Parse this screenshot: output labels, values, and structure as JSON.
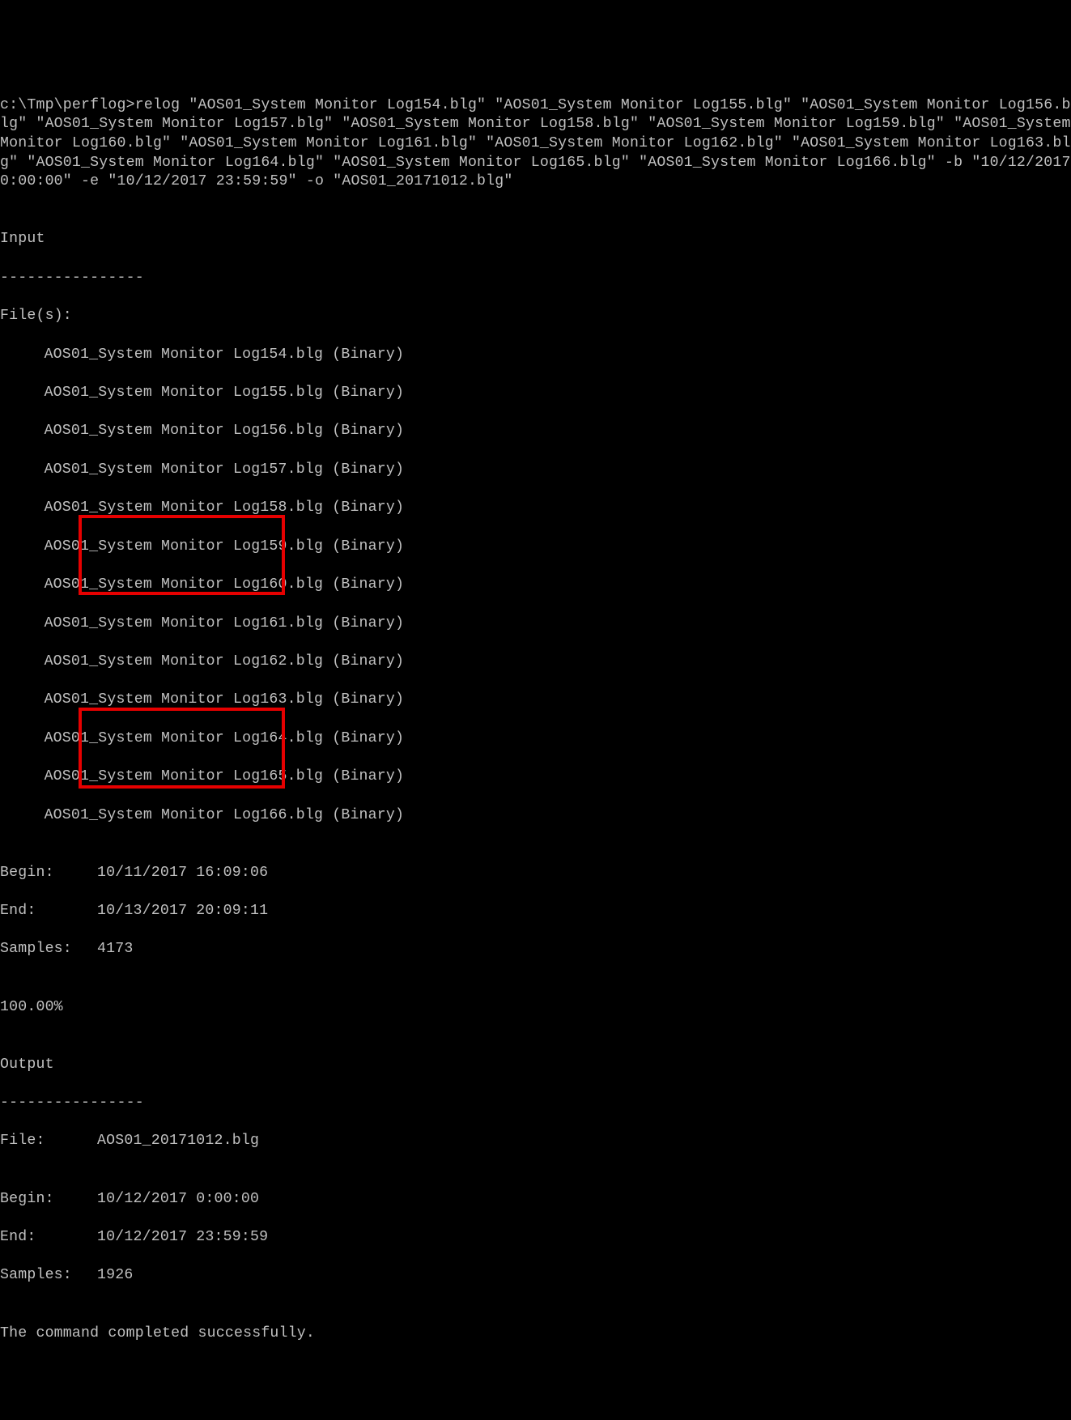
{
  "prompt": "c:\\Tmp\\perflog>",
  "command": "relog \"AOS01_System Monitor Log154.blg\" \"AOS01_System Monitor Log155.blg\" \"AOS01_System Monitor Log156.blg\" \"AOS01_System Monitor Log157.blg\" \"AOS01_System Monitor Log158.blg\" \"AOS01_System Monitor Log159.blg\" \"AOS01_System Monitor Log160.blg\" \"AOS01_System Monitor Log161.blg\" \"AOS01_System Monitor Log162.blg\" \"AOS01_System Monitor Log163.blg\" \"AOS01_System Monitor Log164.blg\" \"AOS01_System Monitor Log165.blg\" \"AOS01_System Monitor Log166.blg\" -b \"10/12/2017 0:00:00\" -e \"10/12/2017 23:59:59\" -o \"AOS01_20171012.blg\"",
  "blank": "",
  "input_heading": "Input",
  "dashes": "----------------",
  "files_heading": "File(s):",
  "files": [
    "AOS01_System Monitor Log154.blg (Binary)",
    "AOS01_System Monitor Log155.blg (Binary)",
    "AOS01_System Monitor Log156.blg (Binary)",
    "AOS01_System Monitor Log157.blg (Binary)",
    "AOS01_System Monitor Log158.blg (Binary)",
    "AOS01_System Monitor Log159.blg (Binary)",
    "AOS01_System Monitor Log160.blg (Binary)",
    "AOS01_System Monitor Log161.blg (Binary)",
    "AOS01_System Monitor Log162.blg (Binary)",
    "AOS01_System Monitor Log163.blg (Binary)",
    "AOS01_System Monitor Log164.blg (Binary)",
    "AOS01_System Monitor Log165.blg (Binary)",
    "AOS01_System Monitor Log166.blg (Binary)"
  ],
  "input_stats": {
    "begin_label": "Begin:",
    "begin_value": "10/11/2017 16:09:06",
    "end_label": "End:",
    "end_value": "10/13/2017 20:09:11",
    "samples_label": "Samples:",
    "samples_value": "4173"
  },
  "percent": "100.00%",
  "output_heading": "Output",
  "output_file_label": "File:",
  "output_file_value": "AOS01_20171012.blg",
  "output_stats": {
    "begin_label": "Begin:",
    "begin_value": "10/12/2017 0:00:00",
    "end_label": "End:",
    "end_value": "10/12/2017 23:59:59",
    "samples_label": "Samples:",
    "samples_value": "1926"
  },
  "success": "The command completed successfully."
}
